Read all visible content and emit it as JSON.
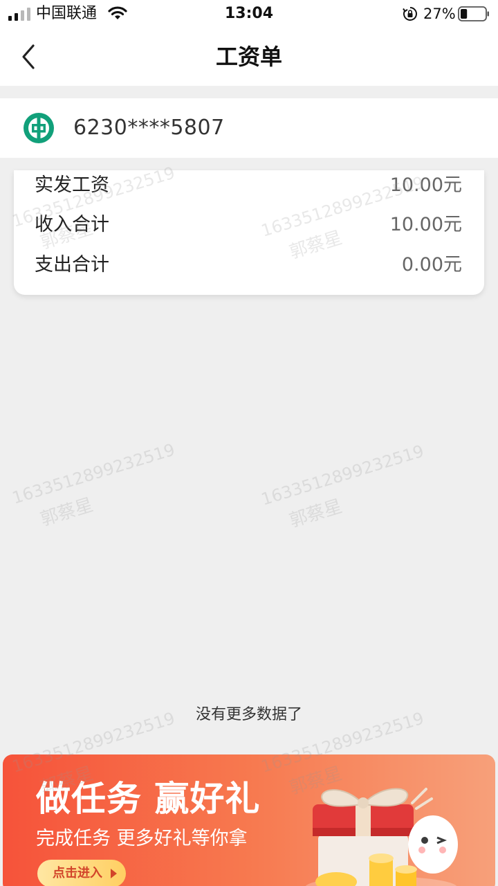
{
  "status_bar": {
    "carrier": "中国联通",
    "time": "13:04",
    "battery_percent": "27%",
    "battery_level": 0.27,
    "icons": [
      "signal-icon",
      "wifi-icon",
      "rotation-lock-icon",
      "battery-icon"
    ]
  },
  "nav": {
    "title": "工资单",
    "back_icon": "chevron-left-icon"
  },
  "account": {
    "bank_logo": "abc-bank-logo",
    "number": "6230****5807"
  },
  "summary": {
    "rows": [
      {
        "label": "实发工资",
        "value": "10.00元"
      },
      {
        "label": "收入合计",
        "value": "10.00元"
      },
      {
        "label": "支出合计",
        "value": "0.00元"
      }
    ]
  },
  "watermark": {
    "id": "16335128992325‌19",
    "name": "郭蔡星"
  },
  "list": {
    "no_more_text": "没有更多数据了"
  },
  "banner": {
    "title": "做任务 赢好礼",
    "subtitle": "完成任务 更多好礼等你拿",
    "button_label": "点击进入",
    "colors": {
      "start": "#f6533a",
      "end": "#f7a07a"
    }
  },
  "colors": {
    "page_background": "#efefef",
    "card_background": "#ffffff",
    "bank_logo_green": "#11a07a"
  }
}
